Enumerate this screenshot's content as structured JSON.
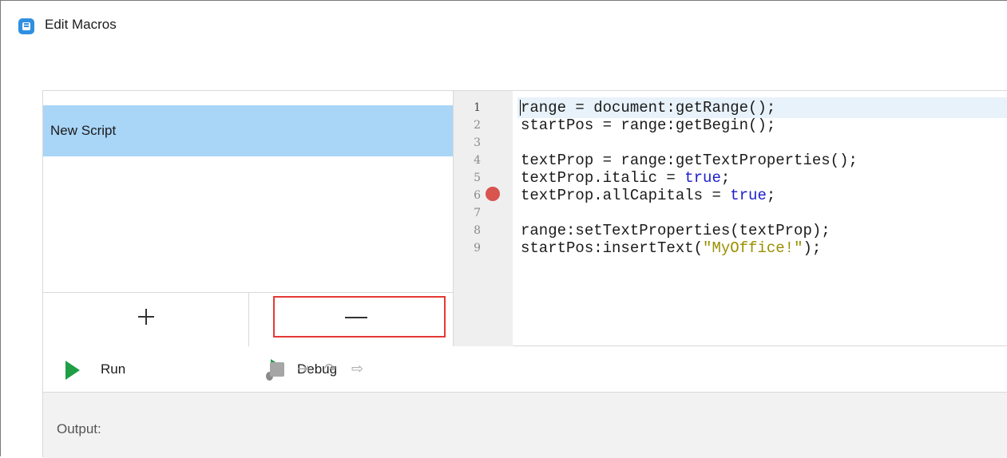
{
  "window": {
    "title": "Edit Macros"
  },
  "scripts": {
    "items": [
      {
        "label": "New Script",
        "selected": true
      }
    ],
    "add_label": "+",
    "remove_label": "−"
  },
  "editor": {
    "line_numbers": [
      "1",
      "2",
      "3",
      "4",
      "5",
      "6",
      "7",
      "8",
      "9"
    ],
    "breakpoint_line": 5,
    "lines": [
      "range = document:getRange();",
      "startPos = range:getBegin();",
      "",
      "textProp = range:getTextProperties();",
      "textProp.italic = true;",
      "textProp.allCapitals = true;",
      "",
      "range:setTextProperties(textProp);",
      "startPos:insertText(\"MyOffice!\");"
    ]
  },
  "toolbar": {
    "run_label": "Run",
    "debug_label": "Debug",
    "icons": [
      "run-icon",
      "debug-icon",
      "stop-icon",
      "step-into-icon",
      "step-over-icon",
      "step-out-icon"
    ]
  },
  "output": {
    "label": "Output:"
  },
  "colors": {
    "selection": "#a9d5f7",
    "run_green": "#1f9e45",
    "breakpoint_red": "#d9534f",
    "highlight_border": "#e53935",
    "keyword_blue": "#1d1dcc",
    "string_olive": "#9a8f00"
  }
}
